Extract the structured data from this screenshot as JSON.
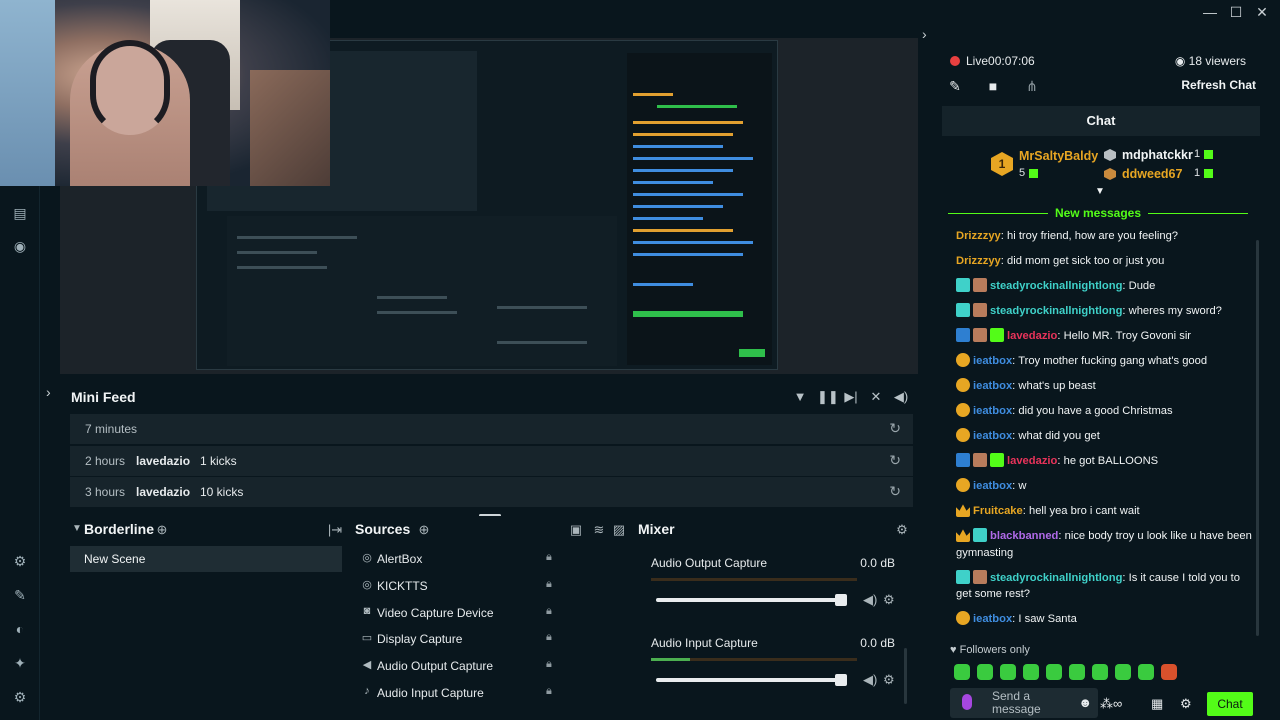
{
  "window": {
    "min": "—",
    "max": "☐",
    "close": "✕"
  },
  "mini_feed": {
    "title": "Mini Feed",
    "rows": [
      {
        "time": "7 minutes",
        "name": "",
        "event": ""
      },
      {
        "time": "2 hours",
        "name": "lavedazio",
        "event": "1 kicks"
      },
      {
        "time": "3 hours",
        "name": "lavedazio",
        "event": "10 kicks"
      }
    ]
  },
  "scenes": {
    "title": "Borderline",
    "items": [
      "New Scene"
    ]
  },
  "sources": {
    "title": "Sources",
    "items": [
      {
        "icon": "globe-icon",
        "label": "AlertBox"
      },
      {
        "icon": "globe-icon",
        "label": "KICKTTS"
      },
      {
        "icon": "camera-icon",
        "label": "Video Capture Device"
      },
      {
        "icon": "monitor-icon",
        "label": "Display Capture"
      },
      {
        "icon": "speaker-icon",
        "label": "Audio Output Capture"
      },
      {
        "icon": "mic-icon",
        "label": "Audio Input Capture"
      }
    ]
  },
  "mixer": {
    "title": "Mixer",
    "channels": [
      {
        "label": "Audio Output Capture",
        "db": "0.0 dB",
        "level": 1.0
      },
      {
        "label": "Audio Input Capture",
        "db": "0.0 dB",
        "level": 1.0
      }
    ]
  },
  "chat": {
    "live_label": "Live",
    "live_time": "00:07:06",
    "viewers": "18 viewers",
    "refresh": "Refresh Chat",
    "title": "Chat",
    "leaderboard": {
      "first": {
        "rank": "1",
        "name": "MrSaltyBaldy",
        "count": "5"
      },
      "second": {
        "name": "mdphatckkr",
        "count": "1"
      },
      "third": {
        "name": "ddweed67",
        "count": "1"
      }
    },
    "new_messages": "New messages",
    "messages": [
      {
        "badges": [],
        "user": "Drizzzyy",
        "color": "#e7a623",
        "text": "hi troy friend, how are you feeling?"
      },
      {
        "badges": [],
        "user": "Drizzzyy",
        "color": "#e7a623",
        "text": "did mom get sick too or just you"
      },
      {
        "badges": [
          "cyan",
          "face"
        ],
        "user": "steadyrockinallnightlong",
        "color": "#3fd1c9",
        "text": "Dude"
      },
      {
        "badges": [
          "cyan",
          "face"
        ],
        "user": "steadyrockinallnightlong",
        "color": "#3fd1c9",
        "text": "wheres my sword?"
      },
      {
        "badges": [
          "blue",
          "face",
          "gift"
        ],
        "user": "lavedazio",
        "color": "#e8335a",
        "text": "Hello MR. Troy Govoni sir"
      },
      {
        "badges": [
          "coin"
        ],
        "user": "ieatbox",
        "color": "#3f8de0",
        "text": "Troy mother fucking gang what's good"
      },
      {
        "badges": [
          "coin"
        ],
        "user": "ieatbox",
        "color": "#3f8de0",
        "text": "what's up beast"
      },
      {
        "badges": [
          "coin"
        ],
        "user": "ieatbox",
        "color": "#3f8de0",
        "text": "did you have a good Christmas"
      },
      {
        "badges": [
          "coin"
        ],
        "user": "ieatbox",
        "color": "#3f8de0",
        "text": "what did you get"
      },
      {
        "badges": [
          "blue",
          "face",
          "gift"
        ],
        "user": "lavedazio",
        "color": "#e8335a",
        "text": "he got BALLOONS"
      },
      {
        "badges": [
          "coin"
        ],
        "user": "ieatbox",
        "color": "#3f8de0",
        "text": "w"
      },
      {
        "badges": [
          "crown"
        ],
        "user": "Fruitcake",
        "color": "#e7a623",
        "text": "hell yea bro i cant wait"
      },
      {
        "badges": [
          "crown",
          "cyan"
        ],
        "user": "blackbanned",
        "color": "#b06ae8",
        "text": "nice body troy u look like u have been gymnasting"
      },
      {
        "badges": [
          "cyan",
          "face"
        ],
        "user": "steadyrockinallnightlong",
        "color": "#3fd1c9",
        "text": "Is it cause I told you to get some rest?"
      },
      {
        "badges": [
          "coin"
        ],
        "user": "ieatbox",
        "color": "#3f8de0",
        "text": "I saw Santa"
      }
    ],
    "followers_only": "Followers only",
    "input_placeholder": "Send a message",
    "send": "Chat"
  }
}
